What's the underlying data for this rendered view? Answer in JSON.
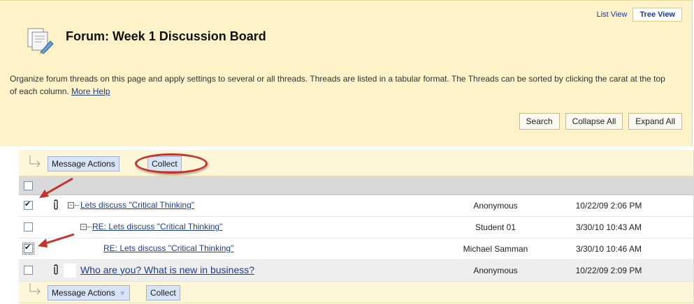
{
  "view_tabs": {
    "list": "List View",
    "tree": "Tree View"
  },
  "page": {
    "title": "Forum: Week 1 Discussion Board",
    "description": "Organize forum threads on this page and apply settings to several or all threads. Threads are listed in a tabular format. The Threads can be sorted by clicking the carat at the top of each column.",
    "more_help": "More Help"
  },
  "top_actions": {
    "search": "Search",
    "collapse_all": "Collapse All",
    "expand_all": "Expand All"
  },
  "action_bar": {
    "message_actions": "Message Actions",
    "collect": "Collect"
  },
  "threads": [
    {
      "title": "Lets discuss \"Critical Thinking\"",
      "author": "Anonymous",
      "date": "10/22/09 2:06 PM",
      "checked": true,
      "attachment": true,
      "level": 0
    },
    {
      "title": "RE: Lets discuss \"Critical Thinking\"",
      "author": "Student 01",
      "date": "3/30/10 10:43 AM",
      "checked": false,
      "attachment": false,
      "level": 1
    },
    {
      "title": "RE: Lets discuss \"Critical Thinking\"",
      "author": "Michael Samman",
      "date": "3/30/10 10:46 AM",
      "checked": true,
      "attachment": false,
      "level": 2
    },
    {
      "title": "Who are you? What is new in business?",
      "author": "Anonymous",
      "date": "10/22/09 2:09 PM",
      "checked": false,
      "attachment": true,
      "level": 0
    }
  ],
  "colors": {
    "accent_red": "#c7332c",
    "link": "#1c3d8c",
    "header_bg": "#fdf2c8",
    "button_blue": "#d8e4f4"
  },
  "icons": {
    "forum": "forum-icon",
    "attachment": "paperclip-icon",
    "collapse": "minus-box-icon",
    "tree_arrow": "tree-arrow-icon",
    "chevron": "chevron-down-icon"
  }
}
